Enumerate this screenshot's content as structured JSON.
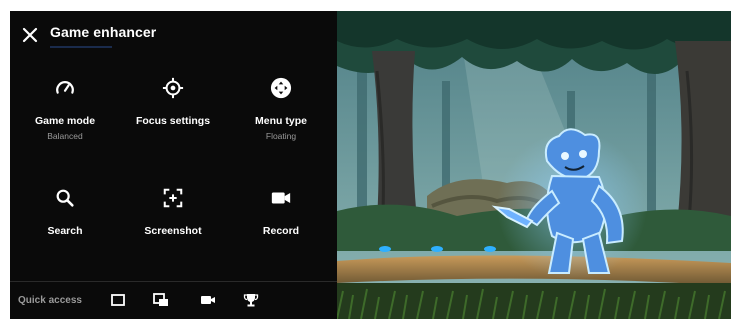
{
  "panel": {
    "title": "Game enhancer",
    "tiles": [
      {
        "label": "Game mode",
        "sub": "Balanced",
        "icon": "speedometer-icon"
      },
      {
        "label": "Focus settings",
        "sub": "",
        "icon": "crosshair-icon"
      },
      {
        "label": "Menu type",
        "sub": "Floating",
        "icon": "gamepad-circle-icon"
      },
      {
        "label": "Search",
        "sub": "",
        "icon": "search-icon"
      },
      {
        "label": "Screenshot",
        "sub": "",
        "icon": "screenshot-icon"
      },
      {
        "label": "Record",
        "sub": "",
        "icon": "video-camera-icon"
      }
    ]
  },
  "quick_access": {
    "label": "Quick access",
    "icons": [
      "window-icon",
      "multi-window-icon",
      "video-camera-icon",
      "trophy-icon"
    ]
  },
  "colors": {
    "panel_bg": "#0a0a0a",
    "text": "#ffffff",
    "subtext": "#9a9a9a",
    "game_character": "#3d8ee6"
  }
}
